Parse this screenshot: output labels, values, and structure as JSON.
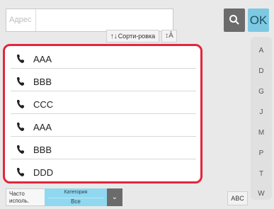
{
  "search": {
    "label": "Адрес",
    "value": ""
  },
  "toolbar": {
    "search_icon": "search-icon",
    "ok_label": "OK"
  },
  "sort": {
    "label": "Сорти-ровка",
    "arrows": "↑↓",
    "order_icon": "sort-order-icon"
  },
  "contacts": [
    {
      "name": "AAA",
      "icon": "phone-icon"
    },
    {
      "name": "BBB",
      "icon": "phone-icon"
    },
    {
      "name": "CCC",
      "icon": "phone-icon"
    },
    {
      "name": "AAA",
      "icon": "phone-icon"
    },
    {
      "name": "BBB",
      "icon": "phone-icon"
    },
    {
      "name": "DDD",
      "icon": "phone-icon"
    }
  ],
  "index_letters": [
    "A",
    "D",
    "G",
    "J",
    "M",
    "P",
    "T",
    "W"
  ],
  "bottom": {
    "frequent_label": "Часто исполь.",
    "category_label": "Категория",
    "category_value": "Все",
    "abc_label": "ABC"
  },
  "colors": {
    "highlight": "#e2263c",
    "accent": "#7ec9e2"
  }
}
